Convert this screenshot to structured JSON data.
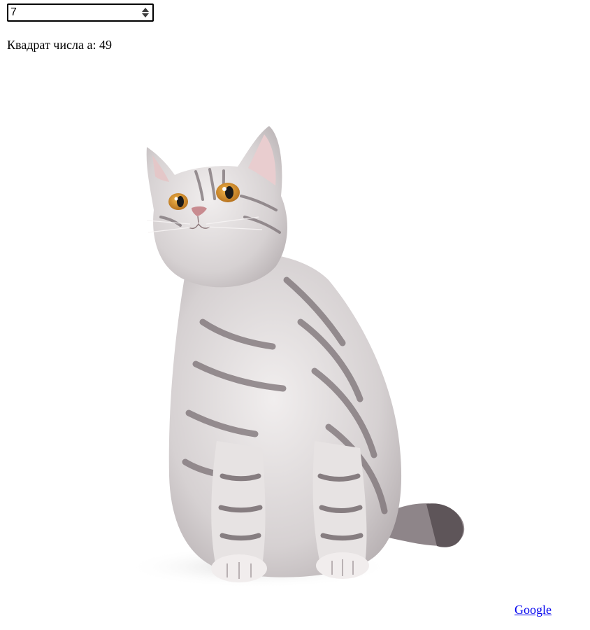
{
  "number_input": {
    "value": "7"
  },
  "result": {
    "label": "Квадрат числа a:",
    "value": "49"
  },
  "image": {
    "subject": "cat-photo"
  },
  "link": {
    "label": "Google"
  },
  "colors": {
    "link": "#0000ee",
    "text": "#000000",
    "background": "#ffffff"
  }
}
